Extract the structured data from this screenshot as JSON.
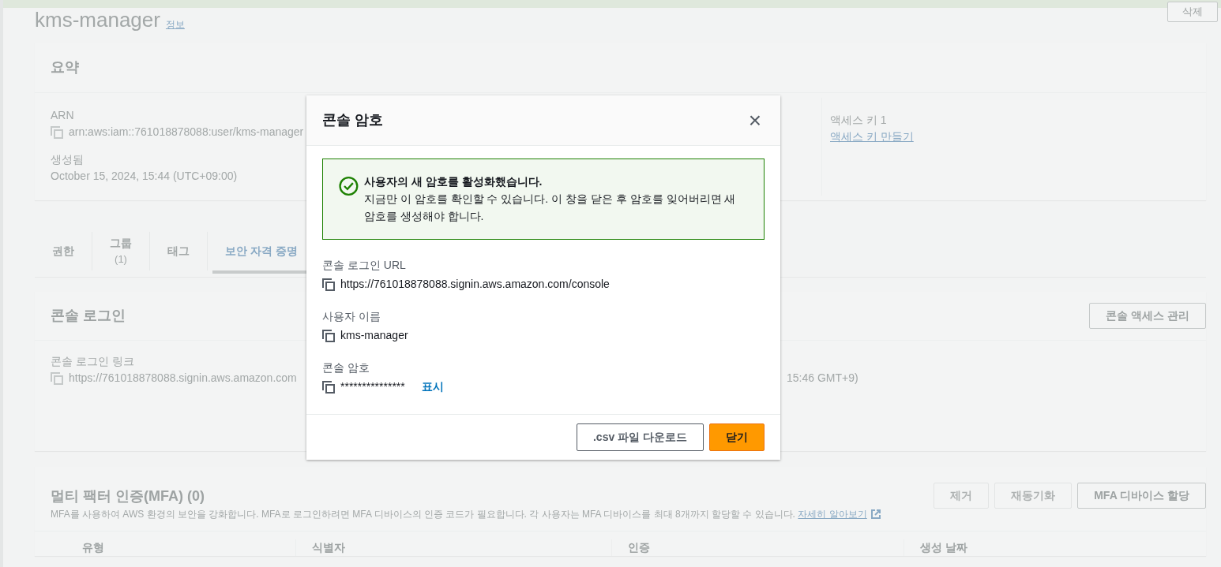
{
  "page": {
    "title": "kms-manager",
    "info_link": "정보",
    "delete_button": "삭제"
  },
  "summary": {
    "heading": "요약",
    "fields": [
      {
        "label": "ARN",
        "value": "arn:aws:iam::761018878088:user/kms-manager",
        "copyable": true
      },
      {
        "label": "생성됨",
        "value": "October 15, 2024, 15:44 (UTC+09:00)",
        "copyable": false
      }
    ],
    "access_key": {
      "label": "액세스 키 1",
      "link": "액세스 키 만들기"
    }
  },
  "tabs": [
    {
      "label": "권한",
      "selected": false
    },
    {
      "label": "그룹",
      "count": "(1)",
      "selected": false
    },
    {
      "label": "태그",
      "selected": false
    },
    {
      "label": "보안 자격 증명",
      "selected": true
    }
  ],
  "console_login": {
    "heading": "콘솔 로그인",
    "manage_button": "콘솔 액세스 관리",
    "link_label": "콘솔 로그인 링크",
    "link_value": "https://761018878088.signin.aws.amazon.com",
    "last_signin": "15:46 GMT+9)"
  },
  "mfa": {
    "heading": "멀티 팩터 인증(MFA) (0)",
    "description": "MFA를 사용하여 AWS 환경의 보안을 강화합니다. MFA로 로그인하려면 MFA 디바이스의 인증 코드가 필요합니다. 각 사용자는 MFA 디바이스를 최대 8개까지 할당할 수 있습니다.",
    "learn_more": "자세히 알아보기",
    "buttons": [
      {
        "label": "제거",
        "disabled": true
      },
      {
        "label": "재동기화",
        "disabled": true
      },
      {
        "label": "MFA 디바이스 할당",
        "disabled": false
      }
    ],
    "columns": [
      "유형",
      "식별자",
      "인증",
      "생성 날짜"
    ]
  },
  "modal": {
    "title": "콘솔 암호",
    "close": "×",
    "alert": {
      "title": "사용자의 새 암호를 활성화했습니다.",
      "message": "지금만 이 암호를 확인할 수 있습니다. 이 창을 닫은 후 암호를 잊어버리면 새 암호를 생성해야 합니다."
    },
    "fields": [
      {
        "label": "콘솔 로그인 URL",
        "value": "https://761018878088.signin.aws.amazon.com/console"
      },
      {
        "label": "사용자 이름",
        "value": "kms-manager"
      },
      {
        "label": "콘솔 암호",
        "value": "***************",
        "action": "표시"
      }
    ],
    "buttons": [
      {
        "label": ".csv 파일 다운로드",
        "kind": "secondary"
      },
      {
        "label": "닫기",
        "kind": "primary"
      }
    ]
  }
}
